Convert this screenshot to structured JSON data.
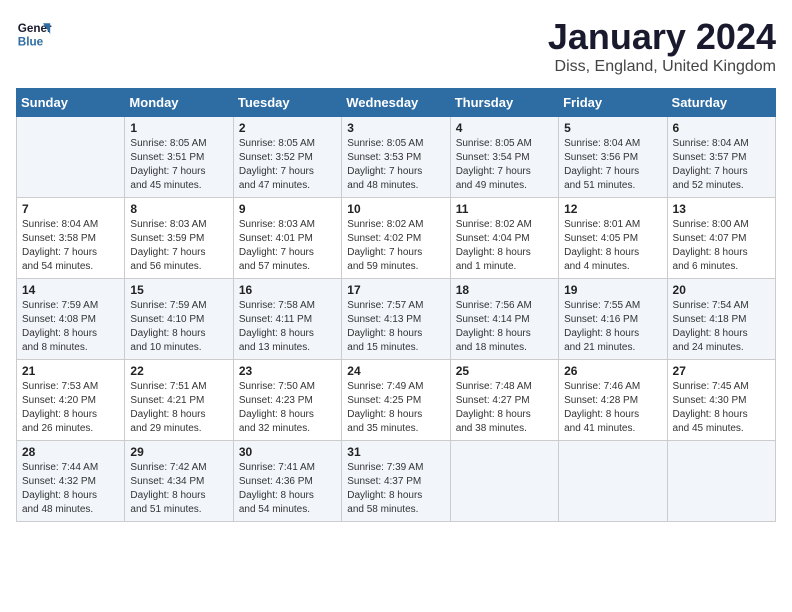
{
  "logo": {
    "line1": "General",
    "line2": "Blue"
  },
  "title": "January 2024",
  "location": "Diss, England, United Kingdom",
  "days_of_week": [
    "Sunday",
    "Monday",
    "Tuesday",
    "Wednesday",
    "Thursday",
    "Friday",
    "Saturday"
  ],
  "weeks": [
    [
      {
        "day": "",
        "info": ""
      },
      {
        "day": "1",
        "info": "Sunrise: 8:05 AM\nSunset: 3:51 PM\nDaylight: 7 hours\nand 45 minutes."
      },
      {
        "day": "2",
        "info": "Sunrise: 8:05 AM\nSunset: 3:52 PM\nDaylight: 7 hours\nand 47 minutes."
      },
      {
        "day": "3",
        "info": "Sunrise: 8:05 AM\nSunset: 3:53 PM\nDaylight: 7 hours\nand 48 minutes."
      },
      {
        "day": "4",
        "info": "Sunrise: 8:05 AM\nSunset: 3:54 PM\nDaylight: 7 hours\nand 49 minutes."
      },
      {
        "day": "5",
        "info": "Sunrise: 8:04 AM\nSunset: 3:56 PM\nDaylight: 7 hours\nand 51 minutes."
      },
      {
        "day": "6",
        "info": "Sunrise: 8:04 AM\nSunset: 3:57 PM\nDaylight: 7 hours\nand 52 minutes."
      }
    ],
    [
      {
        "day": "7",
        "info": "Sunrise: 8:04 AM\nSunset: 3:58 PM\nDaylight: 7 hours\nand 54 minutes."
      },
      {
        "day": "8",
        "info": "Sunrise: 8:03 AM\nSunset: 3:59 PM\nDaylight: 7 hours\nand 56 minutes."
      },
      {
        "day": "9",
        "info": "Sunrise: 8:03 AM\nSunset: 4:01 PM\nDaylight: 7 hours\nand 57 minutes."
      },
      {
        "day": "10",
        "info": "Sunrise: 8:02 AM\nSunset: 4:02 PM\nDaylight: 7 hours\nand 59 minutes."
      },
      {
        "day": "11",
        "info": "Sunrise: 8:02 AM\nSunset: 4:04 PM\nDaylight: 8 hours\nand 1 minute."
      },
      {
        "day": "12",
        "info": "Sunrise: 8:01 AM\nSunset: 4:05 PM\nDaylight: 8 hours\nand 4 minutes."
      },
      {
        "day": "13",
        "info": "Sunrise: 8:00 AM\nSunset: 4:07 PM\nDaylight: 8 hours\nand 6 minutes."
      }
    ],
    [
      {
        "day": "14",
        "info": "Sunrise: 7:59 AM\nSunset: 4:08 PM\nDaylight: 8 hours\nand 8 minutes."
      },
      {
        "day": "15",
        "info": "Sunrise: 7:59 AM\nSunset: 4:10 PM\nDaylight: 8 hours\nand 10 minutes."
      },
      {
        "day": "16",
        "info": "Sunrise: 7:58 AM\nSunset: 4:11 PM\nDaylight: 8 hours\nand 13 minutes."
      },
      {
        "day": "17",
        "info": "Sunrise: 7:57 AM\nSunset: 4:13 PM\nDaylight: 8 hours\nand 15 minutes."
      },
      {
        "day": "18",
        "info": "Sunrise: 7:56 AM\nSunset: 4:14 PM\nDaylight: 8 hours\nand 18 minutes."
      },
      {
        "day": "19",
        "info": "Sunrise: 7:55 AM\nSunset: 4:16 PM\nDaylight: 8 hours\nand 21 minutes."
      },
      {
        "day": "20",
        "info": "Sunrise: 7:54 AM\nSunset: 4:18 PM\nDaylight: 8 hours\nand 24 minutes."
      }
    ],
    [
      {
        "day": "21",
        "info": "Sunrise: 7:53 AM\nSunset: 4:20 PM\nDaylight: 8 hours\nand 26 minutes."
      },
      {
        "day": "22",
        "info": "Sunrise: 7:51 AM\nSunset: 4:21 PM\nDaylight: 8 hours\nand 29 minutes."
      },
      {
        "day": "23",
        "info": "Sunrise: 7:50 AM\nSunset: 4:23 PM\nDaylight: 8 hours\nand 32 minutes."
      },
      {
        "day": "24",
        "info": "Sunrise: 7:49 AM\nSunset: 4:25 PM\nDaylight: 8 hours\nand 35 minutes."
      },
      {
        "day": "25",
        "info": "Sunrise: 7:48 AM\nSunset: 4:27 PM\nDaylight: 8 hours\nand 38 minutes."
      },
      {
        "day": "26",
        "info": "Sunrise: 7:46 AM\nSunset: 4:28 PM\nDaylight: 8 hours\nand 41 minutes."
      },
      {
        "day": "27",
        "info": "Sunrise: 7:45 AM\nSunset: 4:30 PM\nDaylight: 8 hours\nand 45 minutes."
      }
    ],
    [
      {
        "day": "28",
        "info": "Sunrise: 7:44 AM\nSunset: 4:32 PM\nDaylight: 8 hours\nand 48 minutes."
      },
      {
        "day": "29",
        "info": "Sunrise: 7:42 AM\nSunset: 4:34 PM\nDaylight: 8 hours\nand 51 minutes."
      },
      {
        "day": "30",
        "info": "Sunrise: 7:41 AM\nSunset: 4:36 PM\nDaylight: 8 hours\nand 54 minutes."
      },
      {
        "day": "31",
        "info": "Sunrise: 7:39 AM\nSunset: 4:37 PM\nDaylight: 8 hours\nand 58 minutes."
      },
      {
        "day": "",
        "info": ""
      },
      {
        "day": "",
        "info": ""
      },
      {
        "day": "",
        "info": ""
      }
    ]
  ]
}
